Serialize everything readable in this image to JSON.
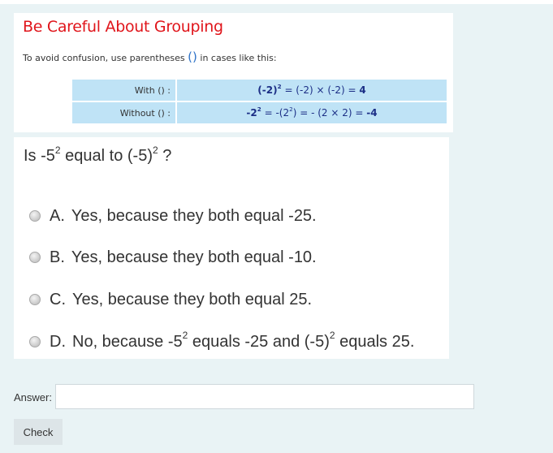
{
  "grouping_card": {
    "title": "Be Careful About Grouping",
    "subtitle_before": "To avoid confusion, use parentheses",
    "subtitle_paren": "()",
    "subtitle_after": "in cases like this:",
    "rows": [
      {
        "label": "With () :",
        "expr_bold": "(-2)",
        "sup": "2",
        "rest": " = (-2) × (-2) = ",
        "result": "4"
      },
      {
        "label": "Without () :",
        "expr_bold": "-2",
        "sup": "2",
        "rest_a": " = -(2",
        "sup2": "2",
        "rest_b": ") = - (2 × 2) = ",
        "result": "-4"
      }
    ]
  },
  "question": {
    "text_a": "Is -5",
    "sup_a": "2",
    "text_b": " equal to (-5)",
    "sup_b": "2",
    "text_c": " ?"
  },
  "options": [
    {
      "letter": "A.",
      "text": "Yes, because they both equal -25."
    },
    {
      "letter": "B.",
      "text": "Yes, because they both equal -10."
    },
    {
      "letter": "C.",
      "text": "Yes, because they both equal 25."
    },
    {
      "letter": "D.",
      "text_a": "No, because -5",
      "sup_a": "2",
      "text_b": " equals -25 and (-5)",
      "sup_b": "2",
      "text_c": " equals 25."
    }
  ],
  "answer": {
    "label": "Answer:",
    "value": ""
  },
  "check_button": {
    "label": "Check"
  }
}
